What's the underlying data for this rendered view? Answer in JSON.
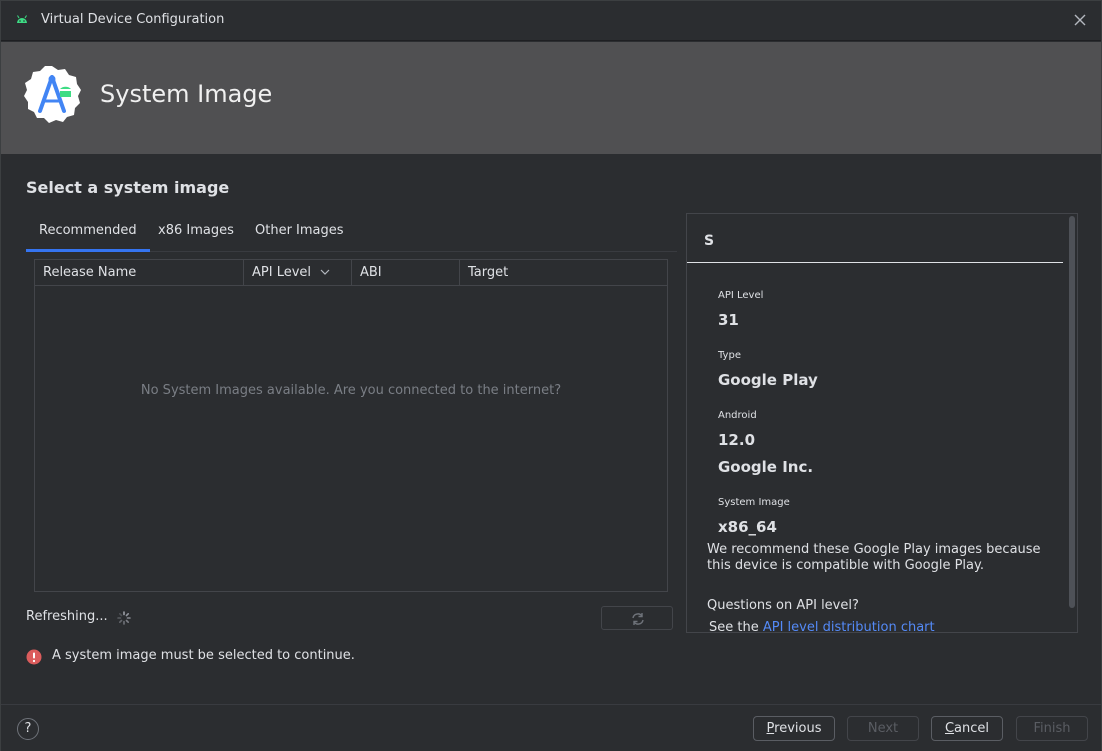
{
  "window": {
    "title": "Virtual Device Configuration",
    "app_icon": "android-icon",
    "close_icon": "close-icon"
  },
  "banner": {
    "heading": "System Image",
    "logo_icon": "android-studio-logo-icon"
  },
  "main": {
    "section_title": "Select a system image",
    "tabs": [
      {
        "label": "Recommended",
        "active": true
      },
      {
        "label": "x86 Images",
        "active": false
      },
      {
        "label": "Other Images",
        "active": false
      }
    ],
    "table": {
      "columns": [
        "Release Name",
        "API Level",
        "ABI",
        "Target"
      ],
      "sorted_column": "API Level",
      "sort_icon": "chevron-down-icon",
      "empty_message": "No System Images available. Are you connected to the internet?"
    },
    "refresh_label": "Refreshing...",
    "refresh_icon": "refresh-icon",
    "error_icon": "error-icon",
    "error_message": "A system image must be selected to continue."
  },
  "info_panel": {
    "name": "S",
    "api_level_label": "API Level",
    "api_level": "31",
    "type_label": "Type",
    "type": "Google Play",
    "android_label": "Android",
    "android_version": "12.0",
    "vendor": "Google Inc.",
    "system_image_label": "System Image",
    "system_image": "x86_64",
    "recommendation": "We recommend these Google Play images because this device is compatible with Google Play.",
    "question": "Questions on API level?",
    "see_the": "See the ",
    "link_text": "API level distribution chart"
  },
  "footer": {
    "help": "?",
    "previous_label": "revious",
    "previous_mnemonic": "P",
    "next_label": "Next",
    "cancel_label": "ancel",
    "cancel_mnemonic": "C",
    "finish_label": "Finish"
  },
  "colors": {
    "accent": "#3574f0",
    "link": "#548af7",
    "error": "#db5c5c",
    "banner": "#505052",
    "background": "#2b2d30"
  }
}
